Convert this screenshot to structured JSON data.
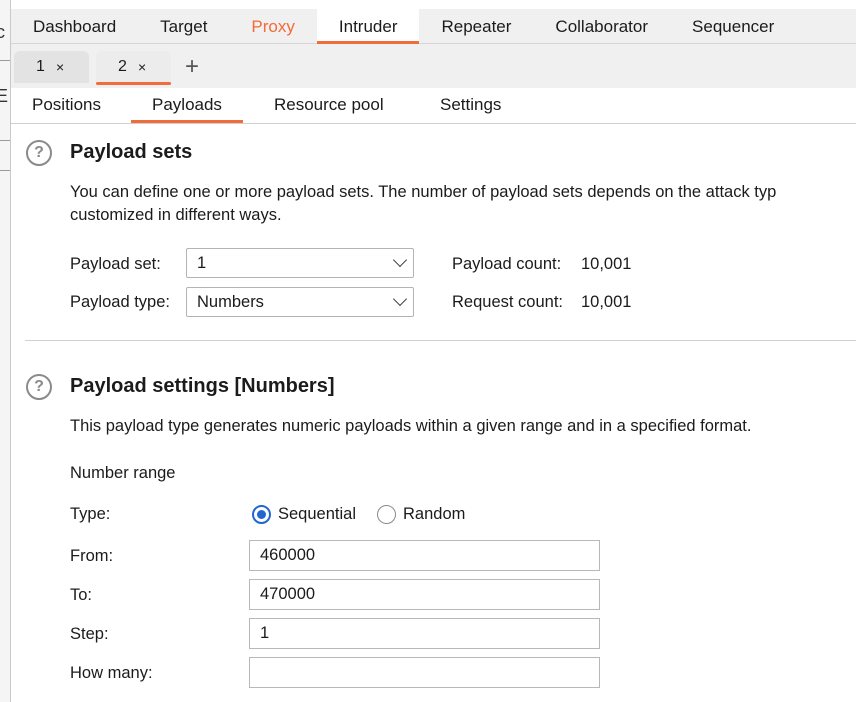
{
  "top_tabs": [
    "Dashboard",
    "Target",
    "Proxy",
    "Intruder",
    "Repeater",
    "Collaborator",
    "Sequencer"
  ],
  "instance_tabs": {
    "tab1": "1",
    "tab2": "2",
    "close": "×",
    "add": "+"
  },
  "sub_tabs": [
    "Positions",
    "Payloads",
    "Resource pool",
    "Settings"
  ],
  "payload_sets": {
    "title": "Payload sets",
    "desc_line1": "You can define one or more payload sets. The number of payload sets depends on the attack typ",
    "desc_line2": "customized in different ways.",
    "set_label": "Payload set:",
    "set_value": "1",
    "type_label": "Payload type:",
    "type_value": "Numbers",
    "payload_count_label": "Payload count:",
    "payload_count": "10,001",
    "request_count_label": "Request count:",
    "request_count": "10,001"
  },
  "payload_settings": {
    "title": "Payload settings [Numbers]",
    "desc": "This payload type generates numeric payloads within a given range and in a specified format.",
    "range_heading": "Number range",
    "type_label": "Type:",
    "sequential_label": "Sequential",
    "random_label": "Random",
    "from_label": "From:",
    "from_value": "460000",
    "to_label": "To:",
    "to_value": "470000",
    "step_label": "Step:",
    "step_value": "1",
    "how_many_label": "How many:",
    "how_many_value": ""
  },
  "help_glyph": "?",
  "colors": {
    "accent": "#f26b3a",
    "radio": "#2366d1"
  }
}
